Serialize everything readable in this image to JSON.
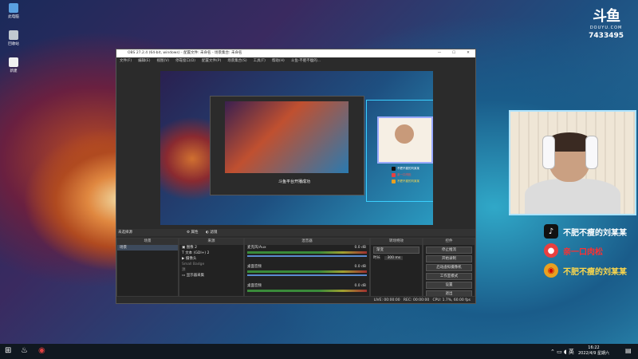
{
  "desktop": {
    "icons": [
      {
        "label": "此电脑",
        "color": "#5aa0e0"
      },
      {
        "label": "回收站",
        "color": "#c0c8d0"
      },
      {
        "label": "新建",
        "color": "#f0f0f0"
      }
    ]
  },
  "brand": {
    "name": "斗鱼",
    "sub": "DOUYU.COM",
    "room_id": "7433495"
  },
  "obs": {
    "title": "OBS 27.2.4 (64-bit, windows) - 配置文件: 未命名 - 场景集合: 未命名",
    "menu": [
      "文件(F)",
      "编辑(E)",
      "视图(V)",
      "停靠窗口(D)",
      "配置文件(P)",
      "场景集合(S)",
      "工具(T)",
      "帮助(H)",
      "斗鱼·不肥不瘦的..."
    ],
    "preview_label": "斗鱼平台开播成功",
    "selected_source_label": "未选择源",
    "tool_row": [
      "属性",
      "滤镜"
    ],
    "docks": {
      "scenes": {
        "title": "场景",
        "items": [
          "场景"
        ]
      },
      "sources": {
        "title": "来源",
        "items": [
          "图像 2",
          "文本 (GDI+) 2",
          "摄像头",
          "Small Badge",
          "源",
          "显示器采集"
        ]
      },
      "mixer": {
        "title": "混音器",
        "channels": [
          {
            "name": "麦克风/Aux",
            "level": "0.0 dB"
          },
          {
            "name": "桌面音频",
            "level": "0.0 dB"
          },
          {
            "name": "桌面音频",
            "level": "0.0 dB"
          }
        ]
      },
      "transitions": {
        "title": "转场特效",
        "type": "渐变",
        "duration_label": "时长",
        "duration": "300 ms"
      },
      "controls": {
        "title": "控件",
        "buttons": [
          "停止推流",
          "开始录制",
          "启动虚拟摄像机",
          "工作室模式",
          "设置",
          "退出"
        ]
      }
    },
    "status": {
      "live": "LIVE: 00:00:00",
      "rec": "REC: 00:00:00",
      "cpu": "CPU: 1.7%, 60.00 fps"
    }
  },
  "overlay": {
    "socials": [
      {
        "icon": "tiktok-icon",
        "label": "不肥不瘦的刘某某",
        "color": "#ffffff",
        "bg": "#111111"
      },
      {
        "icon": "douyu-fish-icon",
        "label": "亲一口肉松",
        "color": "#ff3030",
        "bg": "#e84040"
      },
      {
        "icon": "weibo-icon",
        "label": "不肥不瘦的刘某某",
        "color": "#ffd84a",
        "bg": "#e8a020"
      }
    ]
  },
  "taskbar": {
    "time": "16:22",
    "date": "2022/4/9 星期六"
  }
}
